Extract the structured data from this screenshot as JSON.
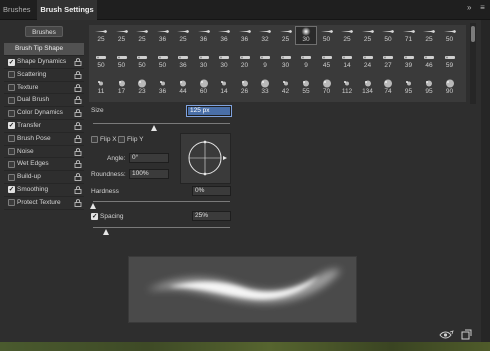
{
  "tabs": {
    "brushes": "Brushes",
    "brush_settings": "Brush Settings"
  },
  "tab_icons": {
    "collapse": "»",
    "menu": "≡"
  },
  "left_panel": {
    "brushes_button": "Brushes",
    "header": "Brush Tip Shape",
    "items": [
      {
        "label": "Shape Dynamics",
        "checked": true
      },
      {
        "label": "Scattering",
        "checked": false
      },
      {
        "label": "Texture",
        "checked": false
      },
      {
        "label": "Dual Brush",
        "checked": false
      },
      {
        "label": "Color Dynamics",
        "checked": false
      },
      {
        "label": "Transfer",
        "checked": true
      },
      {
        "label": "Brush Pose",
        "checked": false
      },
      {
        "label": "Noise",
        "checked": false
      },
      {
        "label": "Wet Edges",
        "checked": false
      },
      {
        "label": "Build-up",
        "checked": false
      },
      {
        "label": "Smoothing",
        "checked": true
      },
      {
        "label": "Protect Texture",
        "checked": false
      }
    ]
  },
  "brush_grid": {
    "rows": [
      [
        "25",
        "25",
        "25",
        "36",
        "25",
        "36",
        "36",
        "36",
        "32",
        "25",
        "30",
        "50",
        "25",
        "25",
        "50",
        "71",
        "25",
        "50"
      ],
      [
        "50",
        "50",
        "50",
        "50",
        "36",
        "30",
        "30",
        "20",
        "9",
        "30",
        "9",
        "45",
        "14",
        "24",
        "27",
        "39",
        "46",
        "59"
      ],
      [
        "11",
        "17",
        "23",
        "36",
        "44",
        "60",
        "14",
        "26",
        "33",
        "42",
        "55",
        "70",
        "112",
        "134",
        "74",
        "95",
        "95",
        "90"
      ]
    ],
    "selected_index": 10
  },
  "size": {
    "label": "Size",
    "value": "125 px",
    "slider": 0.45
  },
  "flip": {
    "flip_x": "Flip X",
    "flip_y": "Flip Y"
  },
  "angle": {
    "label": "Angle:",
    "value": "0°"
  },
  "roundness": {
    "label": "Roundness:",
    "value": "100%"
  },
  "hardness": {
    "label": "Hardness",
    "value": "0%",
    "slider": 0.0
  },
  "spacing": {
    "label": "Spacing",
    "value": "25%",
    "checked": true,
    "slider": 0.1
  },
  "colors": {
    "accent": "#4a6fa8",
    "panel": "#323232",
    "field": "#3b3b3b"
  }
}
